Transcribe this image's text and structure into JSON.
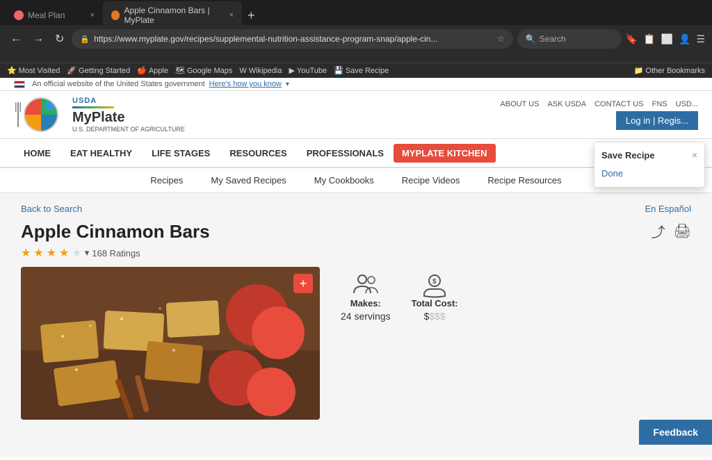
{
  "browser": {
    "tabs": [
      {
        "id": "tab1",
        "label": "Meal Plan",
        "active": false
      },
      {
        "id": "tab2",
        "label": "Apple Cinnamon Bars | MyPlate",
        "active": true
      }
    ],
    "address": "https://www.myplate.gov/recipes/supplemental-nutrition-assistance-program-snap/apple-cin...",
    "search_placeholder": "Search",
    "bookmarks": [
      {
        "label": "Most Visited"
      },
      {
        "label": "Getting Started"
      },
      {
        "label": "Apple"
      },
      {
        "label": "Google Maps"
      },
      {
        "label": "Wikipedia"
      },
      {
        "label": "YouTube"
      },
      {
        "label": "Save Recipe"
      },
      {
        "label": "Other Bookmarks"
      }
    ]
  },
  "official_bar": {
    "text": "An official website of the United States government",
    "link": "Here's how you know"
  },
  "header": {
    "usda_label": "USDA",
    "myplate_label": "MyPlate",
    "dept_label": "U.S. DEPARTMENT OF AGRICULTURE",
    "top_links": [
      {
        "label": "ABOUT US"
      },
      {
        "label": "ASK USDA"
      },
      {
        "label": "CONTACT US"
      },
      {
        "label": "FNS"
      },
      {
        "label": "USD..."
      }
    ],
    "login_label": "Log in | Regis..."
  },
  "main_nav": {
    "items": [
      {
        "label": "HOME"
      },
      {
        "label": "EAT HEALTHY"
      },
      {
        "label": "LIFE STAGES"
      },
      {
        "label": "RESOURCES"
      },
      {
        "label": "PROFESSIONALS"
      },
      {
        "label": "MYPLATE KITCHEN"
      }
    ]
  },
  "sub_nav": {
    "items": [
      {
        "label": "Recipes"
      },
      {
        "label": "My Saved Recipes"
      },
      {
        "label": "My Cookbooks"
      },
      {
        "label": "Recipe Videos"
      },
      {
        "label": "Recipe Resources"
      }
    ]
  },
  "recipe": {
    "back_label": "Back to Search",
    "spanish_label": "En Español",
    "title": "Apple Cinnamon Bars",
    "rating_count": "168 Ratings",
    "stars_filled": 4,
    "stars_total": 5,
    "makes_label": "Makes:",
    "makes_value": "24 servings",
    "cost_label": "Total Cost:",
    "cost_value": "$",
    "cost_gray": "$$$"
  },
  "save_recipe_popup": {
    "title": "Save Recipe",
    "close_label": "×",
    "done_label": "Done"
  },
  "feedback": {
    "label": "Feedback"
  }
}
